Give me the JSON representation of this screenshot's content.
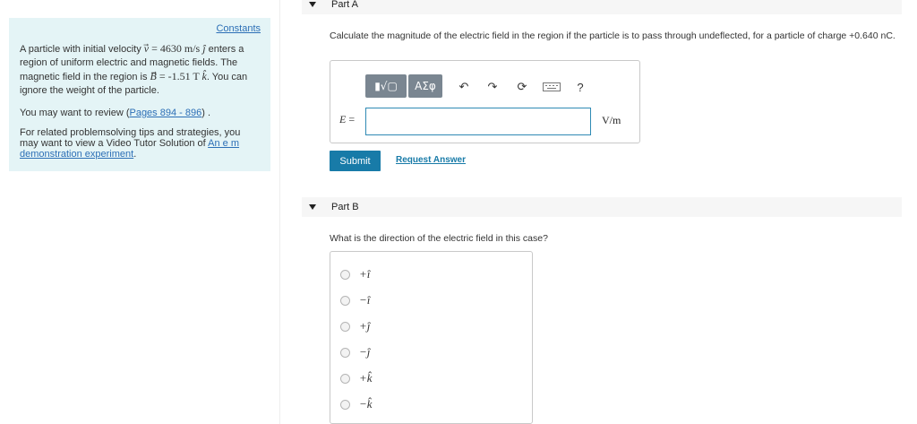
{
  "left_panel": {
    "constants_label": "Constants",
    "intro_pre": "A particle with initial velocity",
    "velocity_var": "v",
    "velocity_value": "= 4630 m/s",
    "velocity_unit_vec": "j",
    "intro_mid": "enters a region of uniform electric and magnetic fields. The magnetic field in the region is",
    "field_var": "B",
    "field_value": "= -1.51 T",
    "field_unit_vec": "k",
    "intro_post": ". You can ignore the weight of the particle.",
    "review_pre": "You may want to review (",
    "review_link": "Pages 894 - 896",
    "review_post": ") .",
    "related_pre": "For related problemsolving tips and strategies, you may want to view a Video Tutor Solution of",
    "related_link": "An e m demonstration experiment",
    "related_post": "."
  },
  "part_a": {
    "title": "Part A",
    "question": "Calculate the magnitude of the electric field in the region if the particle is to pass through undeflected, for a particle of charge +0.640 nC.",
    "toolbar": {
      "template_label": "▮√▢",
      "greek_label": "ΑΣφ",
      "undo_icon": "undo-icon",
      "redo_icon": "redo-icon",
      "reset_icon": "reset-icon",
      "keyboard_icon": "keyboard-icon",
      "help_label": "?"
    },
    "input_label": "E =",
    "input_value": "",
    "unit": "V/m",
    "submit_label": "Submit",
    "request_label": "Request Answer"
  },
  "part_b": {
    "title": "Part B",
    "question": "What is the direction of the electric field in this case?",
    "choices": [
      "+î",
      "−î",
      "+ĵ",
      "−ĵ",
      "+k̂",
      "−k̂"
    ]
  },
  "colors": {
    "panel_bg": "#e4f4f6",
    "link": "#2c6fb6",
    "submit": "#187ba8",
    "toolbar_button": "#7a8691"
  }
}
